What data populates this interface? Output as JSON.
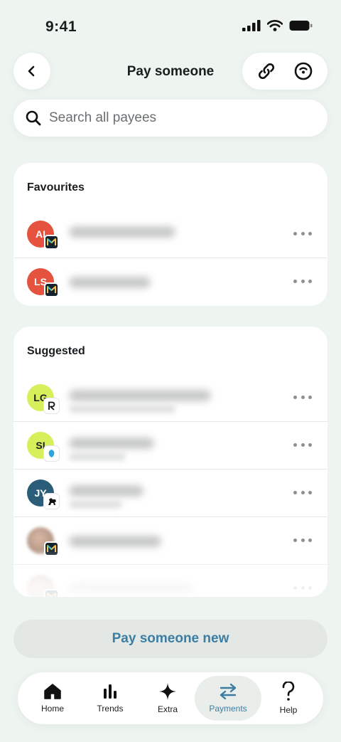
{
  "status_bar": {
    "time": "9:41"
  },
  "header": {
    "title": "Pay someone"
  },
  "search": {
    "placeholder": "Search all payees"
  },
  "favourites": {
    "title": "Favourites",
    "items": [
      {
        "initials": "AI",
        "avatar_color": "#e5533f",
        "bank": "monzo"
      },
      {
        "initials": "LS",
        "avatar_color": "#e5533f",
        "bank": "monzo"
      }
    ]
  },
  "suggested": {
    "title": "Suggested",
    "items": [
      {
        "initials": "LG",
        "avatar_color": "#d6ef5b",
        "bank": "revolut"
      },
      {
        "initials": "SI",
        "avatar_color": "#d6ef5b",
        "bank": "barclays"
      },
      {
        "initials": "JY",
        "avatar_color": "#2c5d78",
        "bank": "lloyds"
      },
      {
        "initials": "",
        "avatar_color": "",
        "bank": "monzo"
      },
      {
        "initials": "",
        "avatar_color": "",
        "bank": "monzo"
      }
    ]
  },
  "actions": {
    "pay_new": "Pay someone new"
  },
  "tab_bar": {
    "tabs": [
      {
        "label": "Home",
        "icon": "home-icon"
      },
      {
        "label": "Trends",
        "icon": "bar-chart-icon"
      },
      {
        "label": "Extra",
        "icon": "sparkle-icon"
      },
      {
        "label": "Payments",
        "icon": "transfer-arrows-icon",
        "active": true
      },
      {
        "label": "Help",
        "icon": "question-icon"
      }
    ]
  },
  "colors": {
    "accent": "#3c7ea3",
    "background": "#eef4ef",
    "monzo_badge": "#15232f"
  }
}
